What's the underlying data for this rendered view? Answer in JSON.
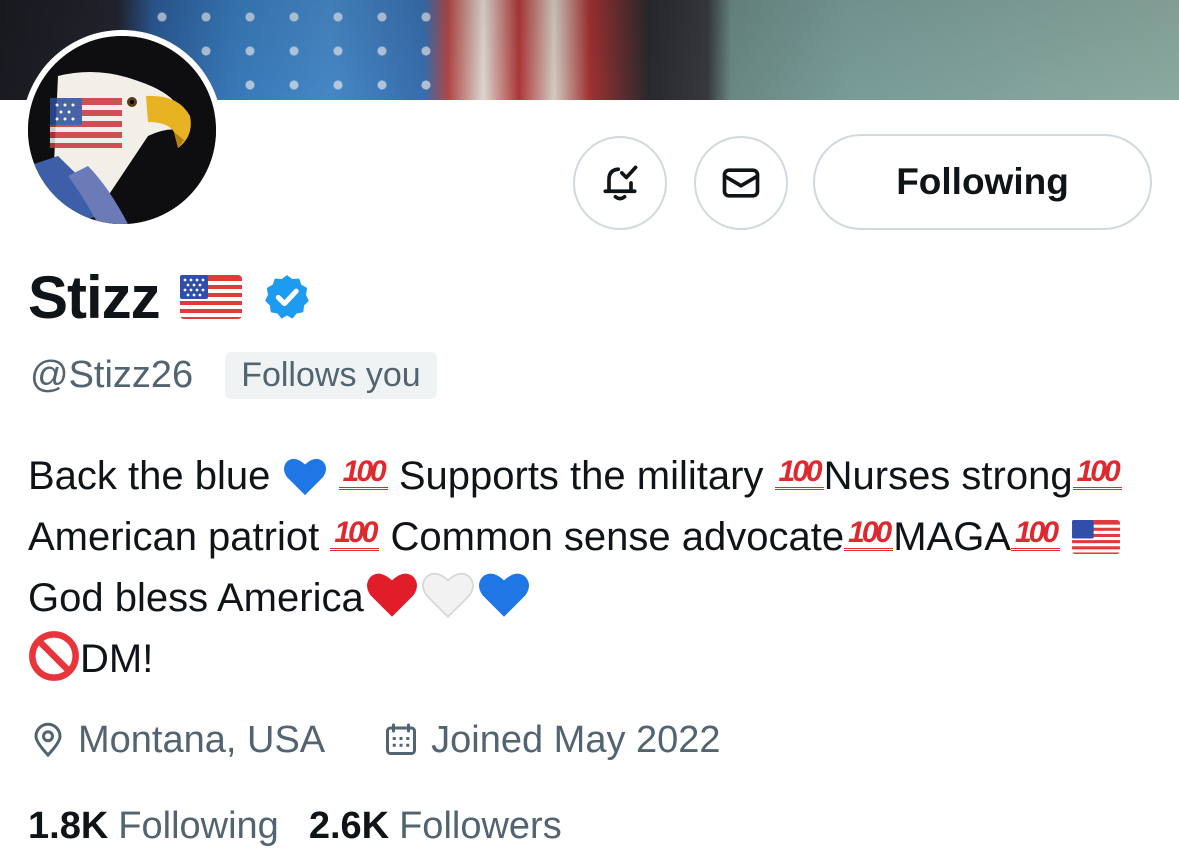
{
  "profile": {
    "display_name": "Stizz",
    "handle": "@Stizz26",
    "follows_you": "Follows you",
    "verified": true
  },
  "actions": {
    "notify_icon": "bell-check-icon",
    "message_icon": "envelope-icon",
    "follow_label": "Following"
  },
  "bio": {
    "t1": "Back the blue",
    "t2": "Supports the military",
    "t3": "Nurses strong",
    "t4": "American patriot",
    "t5": "Common sense advocate",
    "t6": "MAGA",
    "t7": "God bless America",
    "t8": "DM!",
    "hundred": "100"
  },
  "meta": {
    "location": "Montana, USA",
    "joined": "Joined May 2022"
  },
  "stats": {
    "following_count": "1.8K",
    "following_label": "Following",
    "followers_count": "2.6K",
    "followers_label": "Followers"
  },
  "colors": {
    "verified_blue": "#1d9bf0",
    "text_primary": "#0f1419",
    "text_secondary": "#536471",
    "border": "#cfd9de"
  }
}
